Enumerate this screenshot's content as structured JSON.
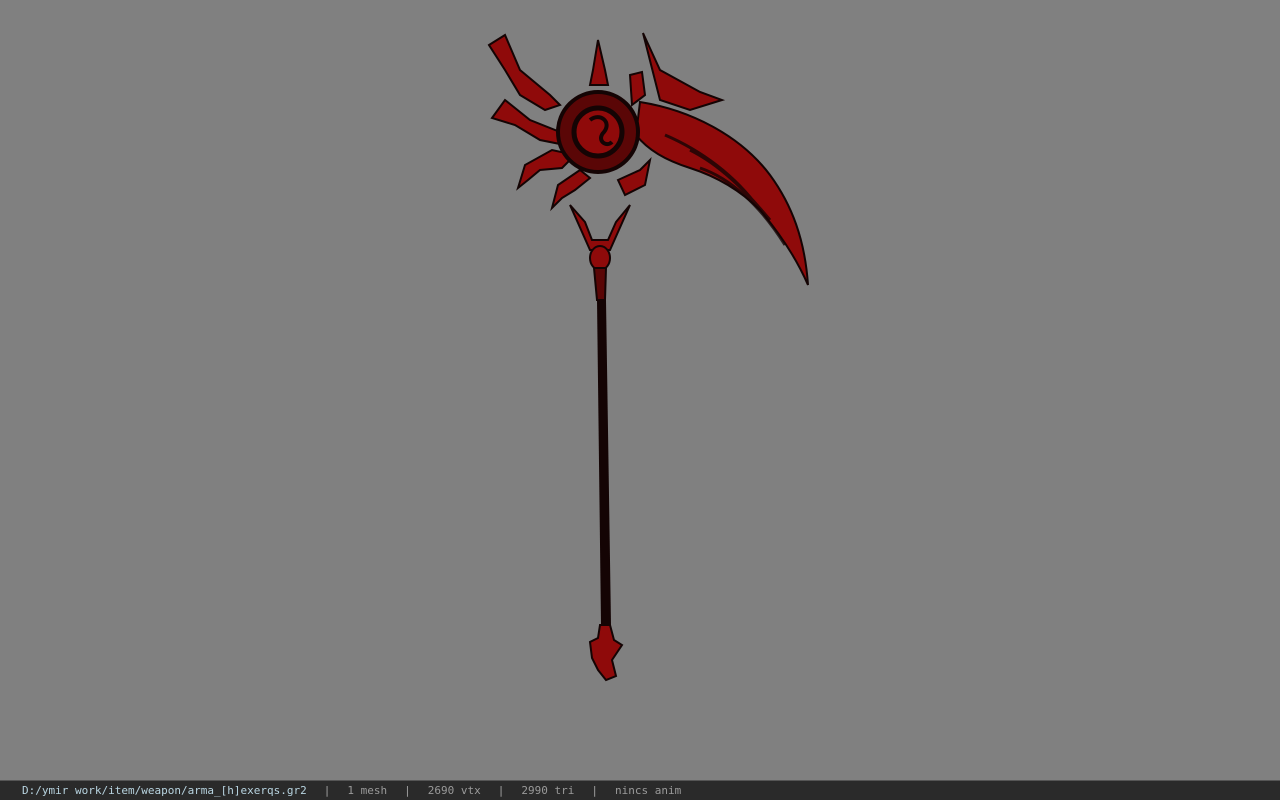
{
  "viewport": {
    "background": "#808080",
    "model": {
      "kind": "scythe-weapon-mesh",
      "colors": {
        "blade": "#8f0a0a",
        "dark": "#140404",
        "mid": "#5a0606"
      }
    }
  },
  "statusbar": {
    "file_path": "D:/ymir work/item/weapon/arma_[h]exerqs.gr2",
    "mesh_count": "1 mesh",
    "vertex_count": "2690 vtx",
    "triangle_count": "2990 tri",
    "anim_status": "nincs anim",
    "separator": "|"
  }
}
